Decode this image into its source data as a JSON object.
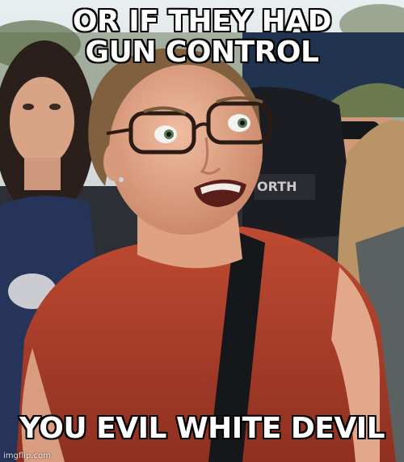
{
  "meme": {
    "top_text": "OR IF THEY HAD GUN CONTROL",
    "bottom_text": "YOU EVIL WHITE DEVIL",
    "watermark": "imgflip.com"
  },
  "photo": {
    "shirt_logo_text": "ORTH",
    "colors": {
      "shirt": "#b3402b",
      "skin": "#e2a889",
      "hair": "#7a5a3a",
      "crowd_dark": "#22262d",
      "sky": "#d9dde0"
    }
  }
}
